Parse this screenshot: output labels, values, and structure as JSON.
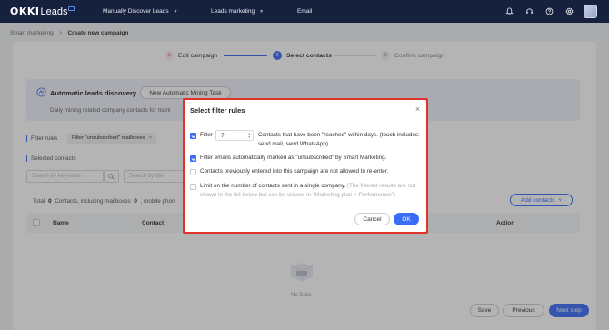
{
  "nav": {
    "logo_okki": "OKKI",
    "logo_leads": "Leads",
    "menu": [
      {
        "label": "Manually Discover Leads",
        "has_caret": true
      },
      {
        "label": "Leads marketing",
        "has_caret": true
      },
      {
        "label": "Email",
        "has_caret": false
      }
    ],
    "icons": [
      "bell-icon",
      "headset-icon",
      "help-icon",
      "settings-icon"
    ]
  },
  "breadcrumb": {
    "parent": "Smart marketing",
    "separator": ">",
    "current": "Create new campaign"
  },
  "steps": [
    {
      "num": "1",
      "label": "Edit campaign",
      "state": "done"
    },
    {
      "num": "2",
      "label": "Select contacts",
      "state": "active"
    },
    {
      "num": "3",
      "label": "Confirm campaign",
      "state": "todo"
    }
  ],
  "auto_leads": {
    "title": "Automatic leads discovery",
    "new_task_label": "New Automatic Mining Task",
    "description": "Daily mining related company contacts for mark"
  },
  "filter": {
    "label": "Filter rules",
    "chip": "Filter \"unsubscribed\" mailboxes",
    "chip_close": "×"
  },
  "selected_contacts": {
    "label": "Selected contacts",
    "search_keywords_placeholder": "Search by keywords",
    "search_title_placeholder": "Search by title"
  },
  "totals": {
    "prefix": "Total",
    "count": "0",
    "middle": "Contacts, including mailboxes",
    "mailbox_count": "0",
    "suffix": ", mobile phon"
  },
  "add_contacts_label": "Add contacts",
  "table": {
    "headers": [
      "Name",
      "Contact",
      "Action"
    ]
  },
  "empty_text": "No Data",
  "footer": {
    "save": "Save",
    "previous": "Previous",
    "next": "Next step"
  },
  "modal": {
    "title": "Select filter rules",
    "close": "×",
    "option1_prefix": "Filter",
    "option1_value": "7",
    "option1_text": "Contacts that have been \"reached\" within days. (touch includes: send mail, send WhatsApp)",
    "option1_checked": true,
    "option2_text": "Filter emails automatically marked as \"unsubscribed\" by Smart Marketing.",
    "option2_checked": true,
    "option3_text": "Contacts previously entered into this campaign are not allowed to re-enter.",
    "option3_checked": false,
    "option4_text": "Limit on the number of contacts sent in a single company.",
    "option4_note": "(The filtered results are not shown in the list below but can be viewed in \"Marketing plan > Performance\")",
    "option4_checked": false,
    "cancel": "Cancel",
    "ok": "OK"
  },
  "colors": {
    "primary": "#3b6cf6",
    "nav_bg": "#16213e",
    "highlight_outline": "#e2312d"
  }
}
